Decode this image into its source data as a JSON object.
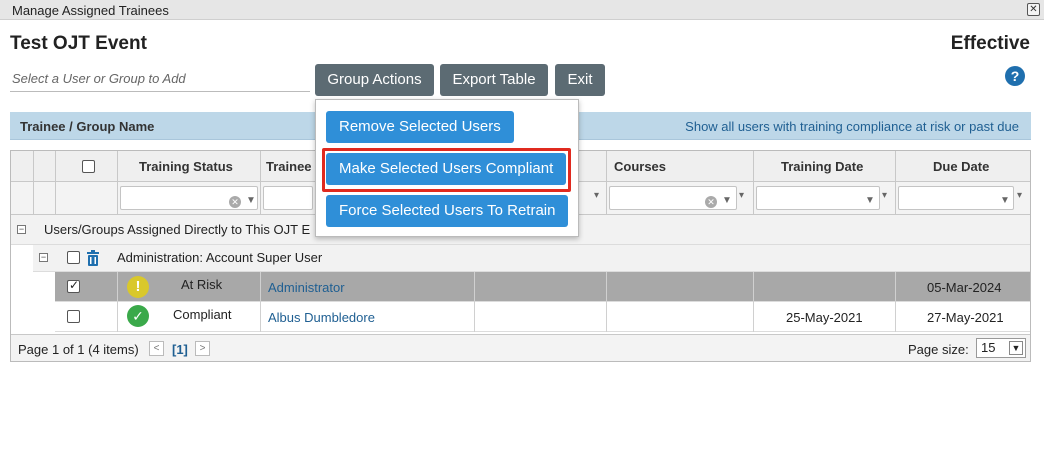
{
  "window": {
    "title": "Manage Assigned Trainees",
    "close_label": "✕"
  },
  "header": {
    "event_title": "Test OJT Event",
    "status": "Effective",
    "help_label": "?"
  },
  "search": {
    "placeholder": "Select a User or Group to Add"
  },
  "toolbar": {
    "group_actions": "Group Actions",
    "export_table": "Export Table",
    "exit": "Exit"
  },
  "group_bar": {
    "label": "Trainee / Group Name",
    "link": "Show all users with training compliance at risk or past due"
  },
  "menu": {
    "items": [
      "Remove Selected Users",
      "Make Selected Users Compliant",
      "Force Selected Users To Retrain"
    ],
    "highlight_color": "#e02a1f"
  },
  "table": {
    "columns": [
      "Training Status",
      "Trainee",
      "Courses",
      "Training Date",
      "Due Date"
    ],
    "group1": {
      "label": "Users/Groups Assigned Directly to This OJT E"
    },
    "group2": {
      "label": "Administration: Account Super User"
    },
    "rows": [
      {
        "status": "At Risk",
        "trainee": "Administrator",
        "training_date": "",
        "due_date": "05-Mar-2024",
        "selected": true
      },
      {
        "status": "Compliant",
        "trainee": "Albus Dumbledore",
        "training_date": "25-May-2021",
        "due_date": "27-May-2021",
        "selected": false
      }
    ]
  },
  "pager": {
    "info": "Page 1 of 1 (4 items)",
    "current": "[1]",
    "size_label": "Page size:",
    "size_value": "15"
  },
  "colors": {
    "button_dark": "#5c6b73",
    "button_blue": "#2f8fd8",
    "group_bar": "#bdd7e8",
    "selected_row": "#a8a8a8"
  }
}
